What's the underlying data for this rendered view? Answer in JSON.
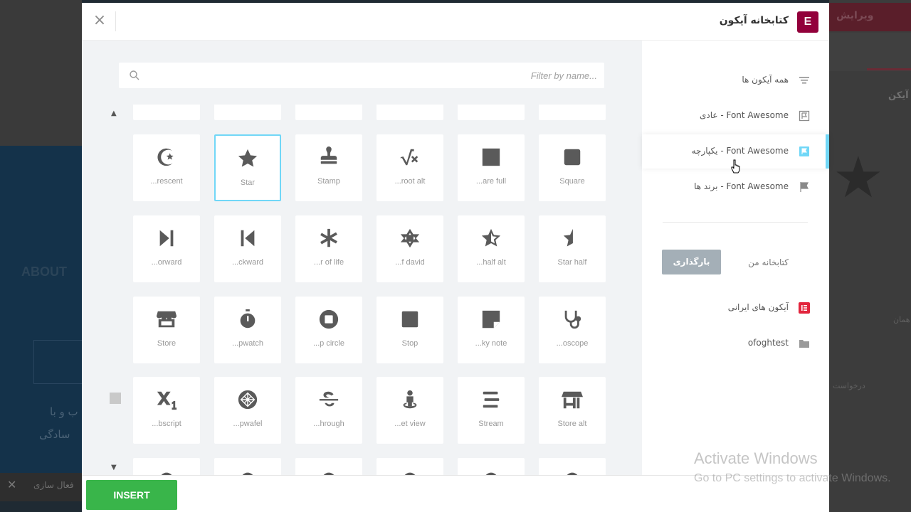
{
  "background": {
    "about_text": "ABOUT",
    "left_text_1": "ب و با",
    "left_text_2": "سادگی",
    "bottom_label": "فعال سازی",
    "right_header": "ویرایش",
    "right_label": "آیکن",
    "right_small_1": "درخواست",
    "right_small_2": "همان"
  },
  "modal": {
    "title": "کتابخانه آیکون",
    "logo_letter": "E",
    "close_glyph": "×"
  },
  "search": {
    "placeholder": "Filter by name..."
  },
  "grid": {
    "partial_top_labels": [
      "",
      "",
      "",
      "",
      "",
      ""
    ],
    "rows": [
      [
        {
          "icon": "star-and-crescent-icon",
          "label": "...rescent"
        },
        {
          "icon": "star-icon",
          "label": "Star",
          "selected": true
        },
        {
          "icon": "stamp-icon",
          "label": "Stamp"
        },
        {
          "icon": "square-root-alt-icon",
          "label": "...root alt"
        },
        {
          "icon": "square-full-icon",
          "label": "...are full"
        },
        {
          "icon": "square-icon",
          "label": "Square"
        }
      ],
      [
        {
          "icon": "step-forward-icon",
          "label": "...orward"
        },
        {
          "icon": "step-backward-icon",
          "label": "...ckward"
        },
        {
          "icon": "star-of-life-icon",
          "label": "...r of life"
        },
        {
          "icon": "star-of-david-icon",
          "label": "...f david"
        },
        {
          "icon": "star-half-alt-icon",
          "label": "...half alt"
        },
        {
          "icon": "star-half-icon",
          "label": "Star half"
        }
      ],
      [
        {
          "icon": "store-icon",
          "label": "Store"
        },
        {
          "icon": "stopwatch-icon",
          "label": "...pwatch"
        },
        {
          "icon": "stop-circle-icon",
          "label": "...p circle"
        },
        {
          "icon": "stop-icon",
          "label": "Stop"
        },
        {
          "icon": "sticky-note-icon",
          "label": "...ky note"
        },
        {
          "icon": "stethoscope-icon",
          "label": "...oscope"
        }
      ],
      [
        {
          "icon": "subscript-icon",
          "label": "...bscript"
        },
        {
          "icon": "stroopwafel-icon",
          "label": "...pwafel"
        },
        {
          "icon": "strikethrough-icon",
          "label": "...hrough"
        },
        {
          "icon": "street-view-icon",
          "label": "...et view"
        },
        {
          "icon": "stream-icon",
          "label": "Stream"
        },
        {
          "icon": "store-alt-icon",
          "label": "Store alt"
        }
      ]
    ]
  },
  "sidebar": {
    "items": [
      {
        "label": "همه آیکون ها",
        "icon": "filter-lines-icon"
      },
      {
        "label": "Font Awesome - عادی",
        "icon": "regular-flag-icon"
      },
      {
        "label": "Font Awesome - یکپارچه",
        "icon": "solid-flag-icon",
        "active": true
      },
      {
        "label": "Font Awesome - برند ها",
        "icon": "brand-flag-icon"
      }
    ],
    "my_library_label": "کتابخانه من",
    "upload_label": "بارگذاری",
    "custom_items": [
      {
        "label": "آیکون های ایرانی",
        "icon": "elementor-logo-icon"
      },
      {
        "label": "ofoghtest",
        "icon": "folder-icon"
      }
    ]
  },
  "footer": {
    "insert_label": "INSERT"
  },
  "watermark": {
    "line1": "Activate Windows",
    "line2": "Go to PC settings to activate Windows."
  },
  "colors": {
    "accent": "#71d7f7",
    "insert": "#39b54a",
    "brand": "#92003b",
    "upload": "#a4afb7"
  }
}
